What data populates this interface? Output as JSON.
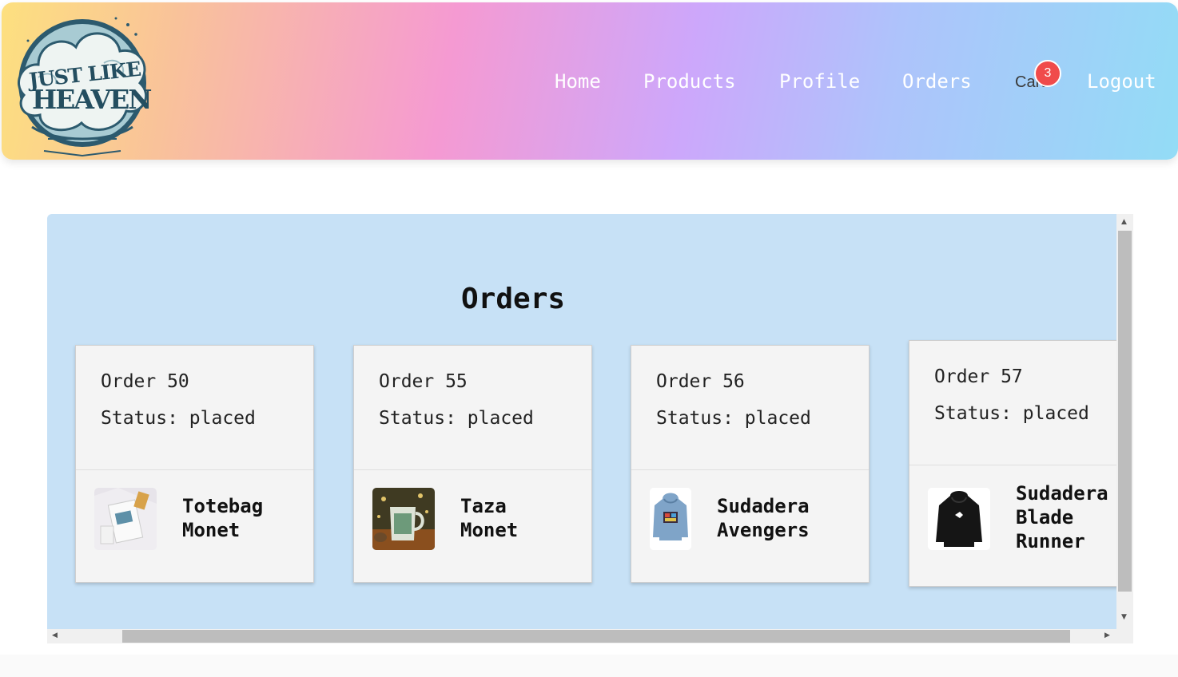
{
  "nav": {
    "brand": "Just Like Heaven",
    "home": "Home",
    "products": "Products",
    "profile": "Profile",
    "orders": "Orders",
    "cart": "Cart",
    "cart_count": "3",
    "logout": "Logout"
  },
  "orders_panel": {
    "title": "Orders",
    "cards": [
      {
        "order": "Order 50",
        "status": "Status: placed",
        "product": "Totebag\nMonet",
        "thumb": "totebag-monet"
      },
      {
        "order": "Order 55",
        "status": "Status: placed",
        "product": "Taza\nMonet",
        "thumb": "mug-monet"
      },
      {
        "order": "Order 56",
        "status": "Status: placed",
        "product": "Sudadera\nAvengers",
        "thumb": "hoodie-avengers"
      },
      {
        "order": "Order 57",
        "status": "Status: placed",
        "product": "Sudadera\nBlade\nRunner",
        "thumb": "hoodie-blade-runner"
      }
    ]
  },
  "colors": {
    "accent_badge": "#f04b4b",
    "panel_bg": "#c7e1f6",
    "card_bg": "#f4f4f4"
  }
}
